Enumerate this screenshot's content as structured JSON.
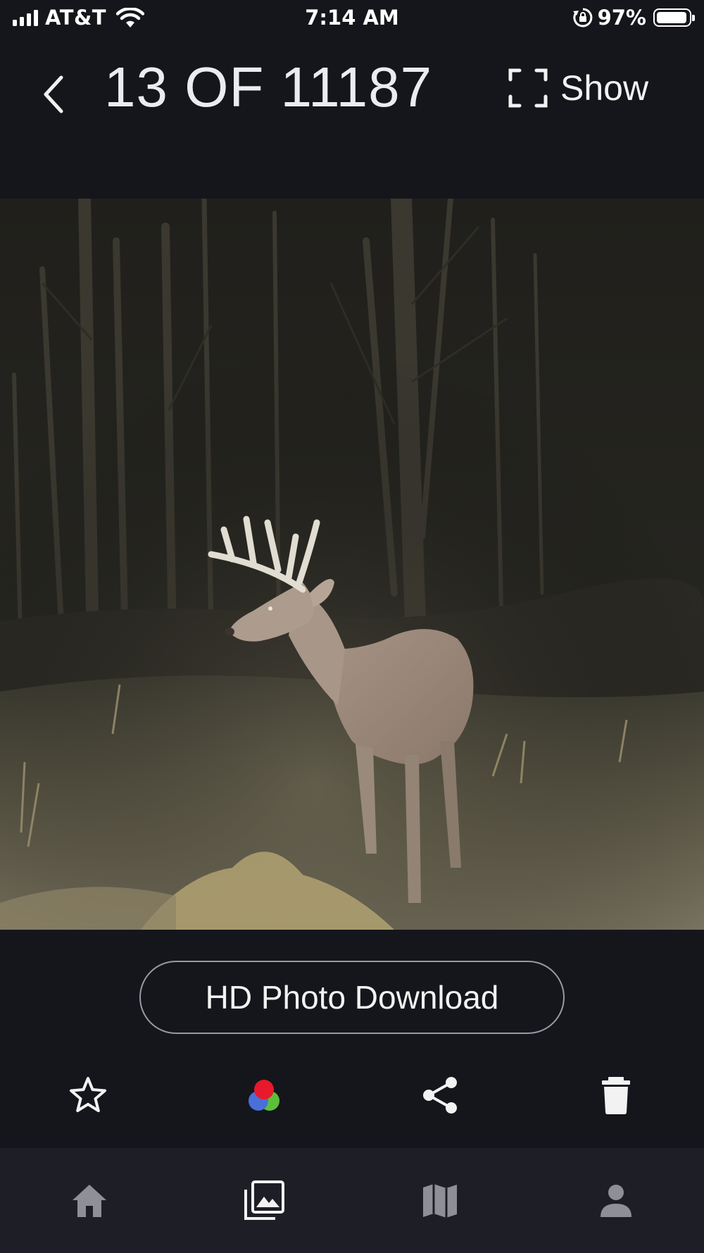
{
  "status_bar": {
    "carrier": "AT&T",
    "time": "7:14 AM",
    "battery_percent": "97%",
    "battery_level": 0.97,
    "icons": [
      "signal-icon",
      "wifi-icon",
      "orientation-lock-icon",
      "battery-icon"
    ]
  },
  "header": {
    "title": "13 OF 11187",
    "show_label": "Show",
    "icons": [
      "back-chevron-icon",
      "fullscreen-icon"
    ]
  },
  "photo": {
    "description_icon": "trail-camera-photo"
  },
  "hd_button": {
    "label": "HD Photo Download"
  },
  "actions": {
    "items": [
      {
        "name": "favorite",
        "icon": "star-outline-icon"
      },
      {
        "name": "filter",
        "icon": "color-circles-icon",
        "colors": [
          "#e8192c",
          "#4a6fd8",
          "#5cbf3a"
        ]
      },
      {
        "name": "share",
        "icon": "share-icon"
      },
      {
        "name": "delete",
        "icon": "trash-icon"
      }
    ]
  },
  "bottom_nav": {
    "items": [
      {
        "name": "home",
        "icon": "home-icon",
        "active": false
      },
      {
        "name": "gallery",
        "icon": "gallery-icon",
        "active": true
      },
      {
        "name": "map",
        "icon": "map-icon",
        "active": false
      },
      {
        "name": "profile",
        "icon": "person-icon",
        "active": false
      }
    ]
  },
  "colors": {
    "background": "#15161b",
    "nav_background": "#1e1f26",
    "active_icon": "#f2f2f2",
    "inactive_icon": "#8e8f98"
  }
}
